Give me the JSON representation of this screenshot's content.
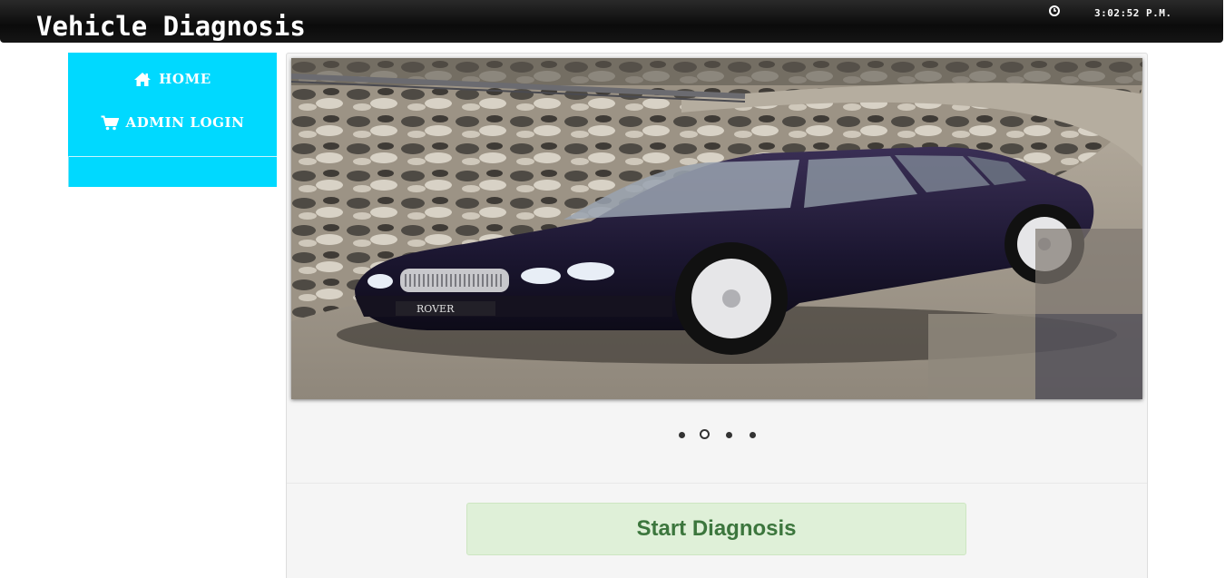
{
  "header": {
    "title": "Vehicle Diagnosis",
    "clock_icon": "clock-icon",
    "time": "3:02:52 P.M."
  },
  "sidebar": {
    "items": [
      {
        "label": "HOME",
        "icon": "home-icon"
      },
      {
        "label": "ADMIN LOGIN",
        "icon": "cart-icon"
      }
    ]
  },
  "slider": {
    "image": "car-photo",
    "dot_count": 4,
    "active_dot": 2
  },
  "main": {
    "start_label": "Start Diagnosis"
  },
  "colors": {
    "sidebar": "#00d9ff",
    "button_bg": "#dff0d8",
    "button_text": "#3c763d"
  }
}
